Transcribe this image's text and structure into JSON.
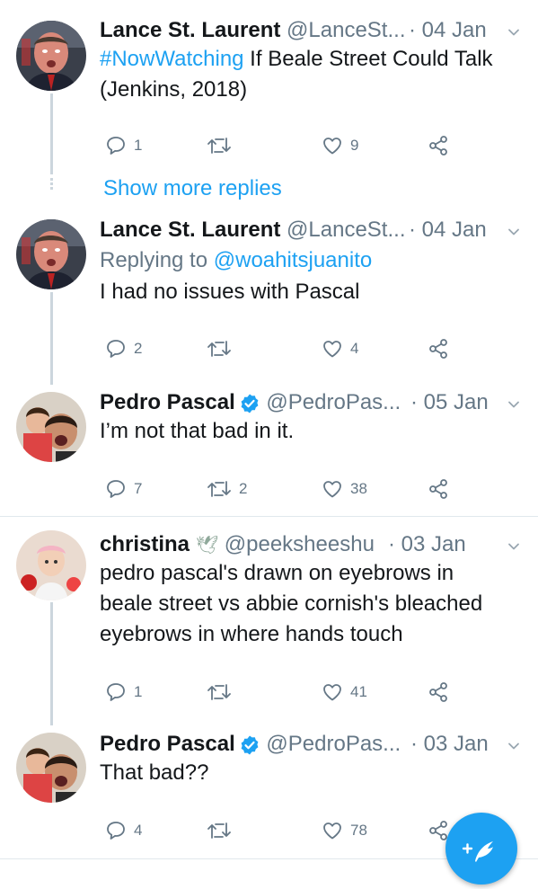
{
  "tweets": [
    {
      "name": "Lance St. Laurent",
      "handle": "@LanceSt...",
      "date": "· 04 Jan",
      "text_hashtag": "#NowWatching",
      "text_rest": " If Beale Street Could Talk",
      "text_line2": "(Jenkins, 2018)",
      "replies": "1",
      "retweets": "",
      "likes": "9"
    },
    {
      "name": "Lance St. Laurent",
      "handle": "@LanceSt...",
      "date": "· 04 Jan",
      "replying_prefix": "Replying to ",
      "replying_to": "@woahitsjuanito",
      "text": "I had no issues with Pascal",
      "replies": "2",
      "retweets": "",
      "likes": "4"
    },
    {
      "name": "Pedro Pascal",
      "handle": "@PedroPas...",
      "date": "· 05 Jan",
      "text": "I’m not that bad in it.",
      "replies": "7",
      "retweets": "2",
      "likes": "38"
    },
    {
      "name": "christina",
      "handle": "@peeksheeshu",
      "date": "· 03 Jan",
      "text_line1": "pedro pascal's drawn on eyebrows in",
      "text_line2": "beale street vs abbie cornish's bleached",
      "text_line3": "eyebrows in where hands touch",
      "replies": "1",
      "retweets": "",
      "likes": "41"
    },
    {
      "name": "Pedro Pascal",
      "handle": "@PedroPas...",
      "date": "· 03 Jan",
      "text": "That bad??",
      "replies": "4",
      "retweets": "",
      "likes": "78"
    }
  ],
  "show_more": "Show more replies",
  "colors": {
    "accent": "#1da1f2",
    "muted": "#657786",
    "divider": "#e1e8ed"
  },
  "icons": [
    "reply-icon",
    "retweet-icon",
    "like-icon",
    "share-icon",
    "chevron-down-icon",
    "verified-badge-icon",
    "dove-emoji-icon",
    "compose-icon"
  ]
}
